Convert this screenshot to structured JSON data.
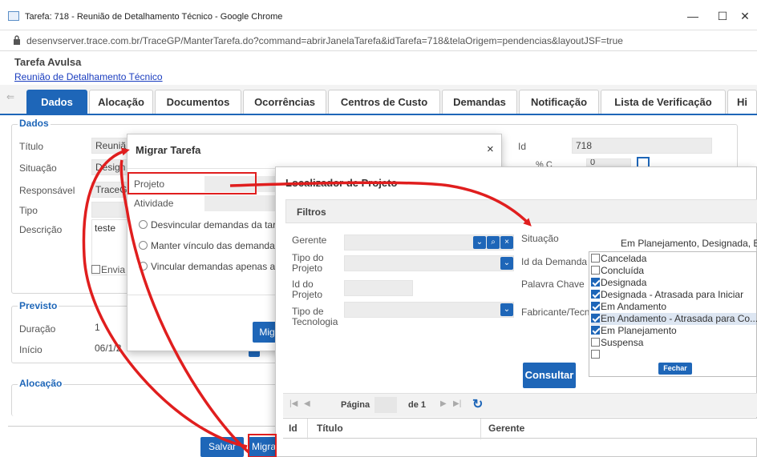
{
  "window": {
    "title": "Tarefa: 718 - Reunião de Detalhamento Técnico - Google Chrome",
    "url": "desenvserver.trace.com.br/TraceGP/ManterTarefa.do?command=abrirJanelaTarefa&idTarefa=718&telaOrigem=pendencias&layoutJSF=true",
    "minimize": "—",
    "maximize": "☐",
    "close": "✕"
  },
  "header": {
    "title": "Tarefa Avulsa",
    "link": "Reunião de Detalhamento Técnico"
  },
  "tabs": [
    "Dados",
    "Alocação",
    "Documentos",
    "Ocorrências",
    "Centros de Custo",
    "Demandas",
    "Notificação",
    "Lista de Verificação",
    "Hi"
  ],
  "dados": {
    "section": "Dados",
    "titulo_label": "Título",
    "titulo_value": "Reuniã",
    "situacao_label": "Situação",
    "situacao_value": "Design",
    "responsavel_label": "Responsável",
    "responsavel_value": "TraceG",
    "tipo_label": "Tipo",
    "descricao_label": "Descrição",
    "descricao_value": "teste",
    "enviar_label": "Envia",
    "id_label": "Id",
    "id_value": "718",
    "pct_label": "% C",
    "pct_value": "0"
  },
  "previsto": {
    "section": "Previsto",
    "duracao_label": "Duração",
    "duracao_value": "1",
    "inicio_label": "Início",
    "inicio_value": "06/1/2"
  },
  "alocacao": {
    "section": "Alocação"
  },
  "footer": {
    "salvar": "Salvar",
    "migrar": "Migra"
  },
  "migrar_dialog": {
    "title": "Migrar Tarefa",
    "close": "×",
    "projeto_label": "Projeto",
    "atividade_label": "Atividade",
    "options": [
      "Desvincular demandas da tar",
      "Manter vínculo das demandas",
      "Vincular demandas apenas a"
    ],
    "button": "Migr"
  },
  "localizador": {
    "title": "Localizador de Projeto",
    "filtros": "Filtros",
    "gerente_label": "Gerente",
    "tipo_projeto_label": "Tipo do Projeto",
    "id_projeto_label": "Id do Projeto",
    "tipo_tecnologia_label": "Tipo de Tecnologia",
    "situacao_label": "Situação",
    "situacao_value": "Em Planejamento, Designada, E",
    "id_demanda_label": "Id da Demanda",
    "palavra_chave_label": "Palavra Chave",
    "fabricante_label": "Fabricante/Tecn",
    "consultar": "Consultar",
    "pager": {
      "pagina": "Página",
      "de": "de 1",
      "first": "|◀",
      "prev": "◀",
      "next": "▶",
      "last": "▶|",
      "refresh": "↻"
    },
    "columns": [
      "Id",
      "Título",
      "Gerente"
    ],
    "dd_chevron": "⌄",
    "dd_search": "⌕",
    "dd_clear": "×"
  },
  "situacao_list": {
    "items": [
      {
        "label": "Cancelada",
        "checked": false
      },
      {
        "label": "Concluída",
        "checked": false
      },
      {
        "label": "Designada",
        "checked": true
      },
      {
        "label": "Designada - Atrasada para Iniciar",
        "checked": true
      },
      {
        "label": "Em Andamento",
        "checked": true
      },
      {
        "label": "Em Andamento - Atrasada para Co...",
        "checked": true
      },
      {
        "label": "Em Planejamento",
        "checked": true
      },
      {
        "label": "Suspensa",
        "checked": false
      },
      {
        "label": "",
        "checked": false
      }
    ],
    "fechar": "Fechar"
  },
  "colors": {
    "accent": "#1e66b8",
    "annotation": "#e01e1e"
  }
}
